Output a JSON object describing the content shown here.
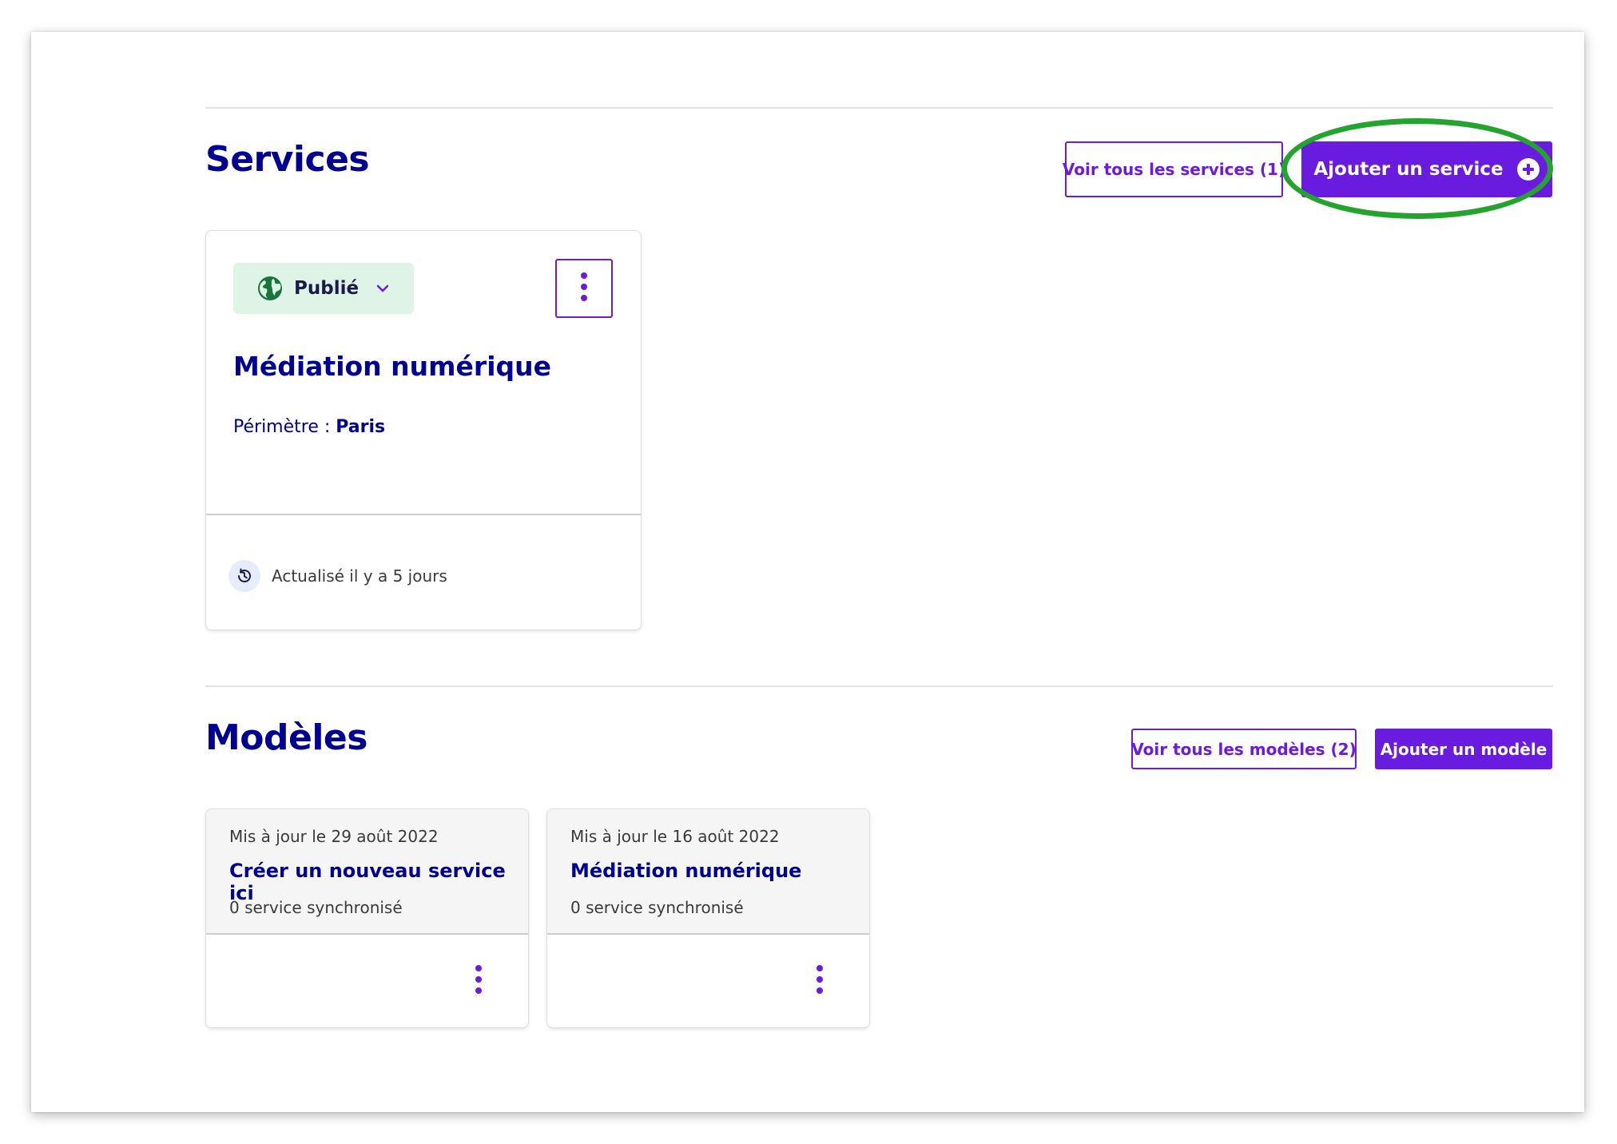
{
  "colors": {
    "primary": "#6a1be0",
    "title_blue": "#000091",
    "published_bg": "#dff3e6",
    "published_icon": "#18753c",
    "highlight": "#24a32f"
  },
  "services": {
    "title": "Services",
    "view_all_label": "Voir tous les services (1)",
    "add_label": "Ajouter un service",
    "add_icon": "plus-circle-icon",
    "card": {
      "status_label": "Publié",
      "status_icon": "globe-icon",
      "title": "Médiation numérique",
      "perimetre_label": "Périmètre : ",
      "perimetre_value": "Paris",
      "updated_text": "Actualisé il y a 5 jours",
      "updated_icon": "history-icon",
      "menu_icon": "kebab-menu-icon"
    }
  },
  "models": {
    "title": "Modèles",
    "view_all_label": "Voir tous les modèles (2)",
    "add_label": "Ajouter un modèle",
    "items": [
      {
        "updated": "Mis à jour le 29 août 2022",
        "title": "Créer un nouveau service ici",
        "synced": "0 service synchronisé"
      },
      {
        "updated": "Mis à jour le 16 août 2022",
        "title": "Médiation numérique",
        "synced": "0 service synchronisé"
      }
    ]
  }
}
